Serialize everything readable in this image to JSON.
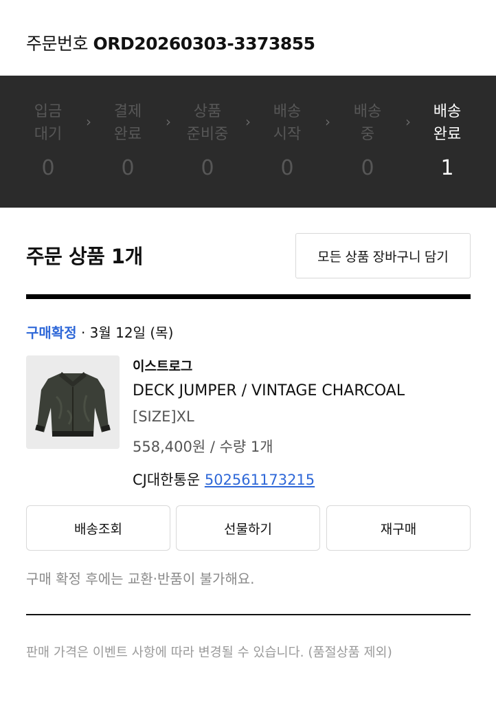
{
  "order": {
    "label": "주문번호",
    "number": "ORD20260303-3373855"
  },
  "status_steps": [
    {
      "label": "입금\n대기",
      "count": "0",
      "active": false
    },
    {
      "label": "결제\n완료",
      "count": "0",
      "active": false
    },
    {
      "label": "상품\n준비중",
      "count": "0",
      "active": false
    },
    {
      "label": "배송\n시작",
      "count": "0",
      "active": false
    },
    {
      "label": "배송\n중",
      "count": "0",
      "active": false
    },
    {
      "label": "배송\n완료",
      "count": "1",
      "active": true
    }
  ],
  "section": {
    "title": "주문 상품 1개",
    "cart_button": "모든 상품 장바구니 담기"
  },
  "item": {
    "status": "구매확정",
    "date": " · 3월 12일 (목)",
    "image_icon": "jacket-image",
    "brand": "이스트로그",
    "name": "DECK JUMPER / VINTAGE CHARCOAL",
    "option": "[SIZE]XL",
    "price_qty": "558,400원 / 수량 1개",
    "carrier": "CJ대한통운",
    "tracking": "502561173215"
  },
  "actions": {
    "track": "배송조회",
    "gift": "선물하기",
    "reorder": "재구매"
  },
  "notes": {
    "confirm_note": "구매 확정 후에는 교환·반품이 불가해요.",
    "price_note": "판매 가격은 이벤트 사항에 따라 변경될 수 있습니다. (품절상품 제외)"
  },
  "colors": {
    "accent": "#2f68d8",
    "status_bg": "#2b2b2b",
    "inactive": "#575757",
    "active": "#ffffff"
  }
}
